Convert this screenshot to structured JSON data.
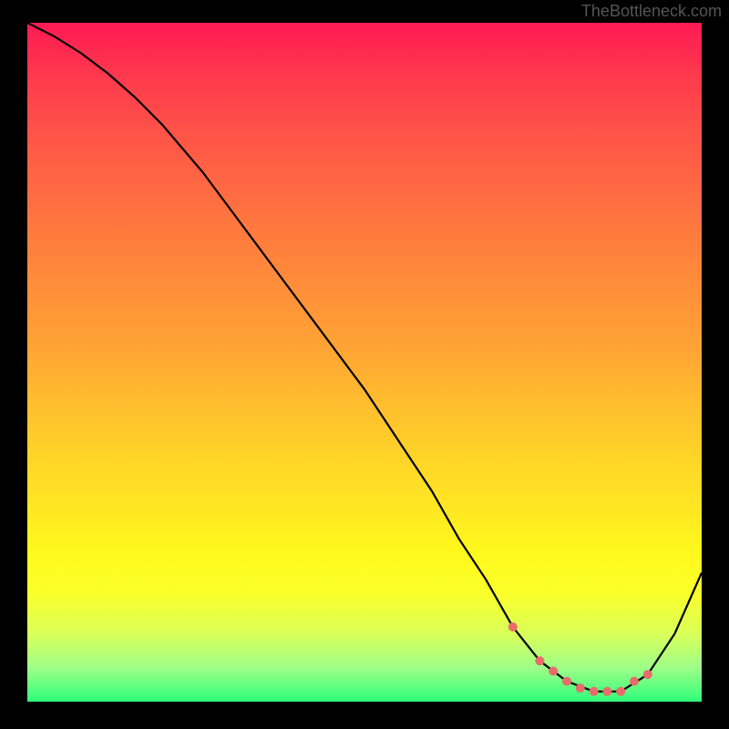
{
  "watermark": "TheBottleneck.com",
  "chart_data": {
    "type": "line",
    "title": "",
    "xlabel": "",
    "ylabel": "",
    "xlim": [
      0,
      100
    ],
    "ylim": [
      0,
      100
    ],
    "series": [
      {
        "name": "curve",
        "x": [
          0,
          4,
          8,
          12,
          16,
          20,
          26,
          32,
          38,
          44,
          50,
          56,
          60,
          64,
          68,
          72,
          76,
          80,
          84,
          88,
          92,
          96,
          100
        ],
        "y": [
          100,
          98,
          95.5,
          92.5,
          89,
          85,
          78,
          70,
          62,
          54,
          46,
          37,
          31,
          24,
          18,
          11,
          6,
          3,
          1.5,
          1.5,
          4,
          10,
          19
        ]
      }
    ],
    "markers": {
      "name": "highlight-zone",
      "x": [
        72,
        76,
        78,
        80,
        82,
        84,
        86,
        88,
        90,
        92
      ],
      "y": [
        11,
        6,
        4.5,
        3,
        2,
        1.5,
        1.5,
        1.5,
        3,
        4
      ]
    },
    "gradient_stops": [
      {
        "pos": 0,
        "color": "#ff1a53"
      },
      {
        "pos": 50,
        "color": "#ffb030"
      },
      {
        "pos": 80,
        "color": "#ffff20"
      },
      {
        "pos": 100,
        "color": "#2eff7a"
      }
    ]
  }
}
